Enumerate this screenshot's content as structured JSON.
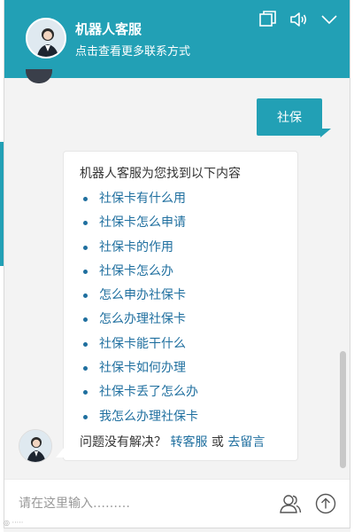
{
  "header": {
    "title": "机器人客服",
    "subtitle": "点击查看更多联系方式"
  },
  "user_message": "社保",
  "bot_message": {
    "intro": "机器人客服为您找到以下内容",
    "links": [
      "社保卡有什么用",
      "社保卡怎么申请",
      "社保卡的作用",
      "社保卡怎么办",
      "怎么申办社保卡",
      "怎么办理社保卡",
      "社保卡能干什么",
      "社保卡如何办理",
      "社保卡丢了怎么办",
      "我怎么办理社保卡"
    ],
    "footer_question": "问题没有解决？",
    "transfer_link": "转客服",
    "or_text": "或",
    "leave_message_link": "去留言"
  },
  "input": {
    "placeholder": "请在这里输入………",
    "value": ""
  },
  "icons": {
    "minimize": "window-restore-icon",
    "sound": "speaker-icon",
    "collapse": "chevron-down-icon",
    "agent": "users-icon",
    "send": "arrow-up-circle-icon"
  },
  "colors": {
    "accent": "#22a0b5",
    "link": "#1f6f9f"
  }
}
